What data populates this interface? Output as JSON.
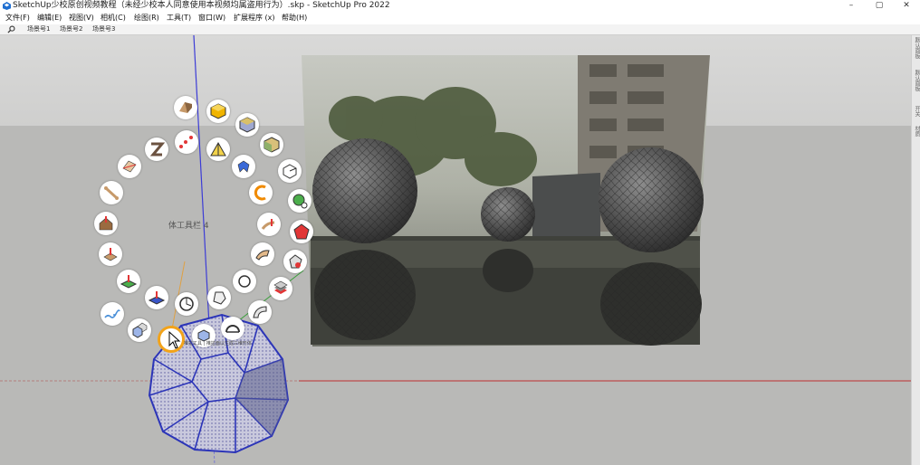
{
  "window": {
    "title": "SketchUp少校原创视频教程（未经少校本人同意使用本视频均属盗用行为）.skp - SketchUp Pro 2022",
    "controls": {
      "minimize": "–",
      "maximize": "▢",
      "close": "✕"
    }
  },
  "menubar": {
    "items": [
      "文件(F)",
      "编辑(E)",
      "视图(V)",
      "相机(C)",
      "绘图(R)",
      "工具(T)",
      "窗口(W)",
      "扩展程序 (x)",
      "帮助(H)"
    ]
  },
  "scenes": {
    "tabs": [
      "场景号1",
      "场景号2",
      "场景号3"
    ]
  },
  "right_tray": {
    "labels": [
      "默认面板",
      "默认面板",
      "开关",
      "材质"
    ]
  },
  "radial_toolbar": {
    "label": "体工具栏 4",
    "hover_hint": "推拉工具 | 推拉面以生成三维形体"
  },
  "colors": {
    "viewport_bg": "#c1c1bf",
    "axis_blue": "#3c3cd6",
    "axis_red": "#c03030",
    "axis_green": "#3aa03a",
    "mesh_blue": "#2c35b8",
    "selection_orange": "#f2a31a"
  },
  "icons": [
    "sketchup-app-icon",
    "search-icon",
    "cursor-arrow-icon",
    "push-pull-icon",
    "offset-icon",
    "follow-me-icon",
    "sphere-icon",
    "intersect-icon"
  ]
}
